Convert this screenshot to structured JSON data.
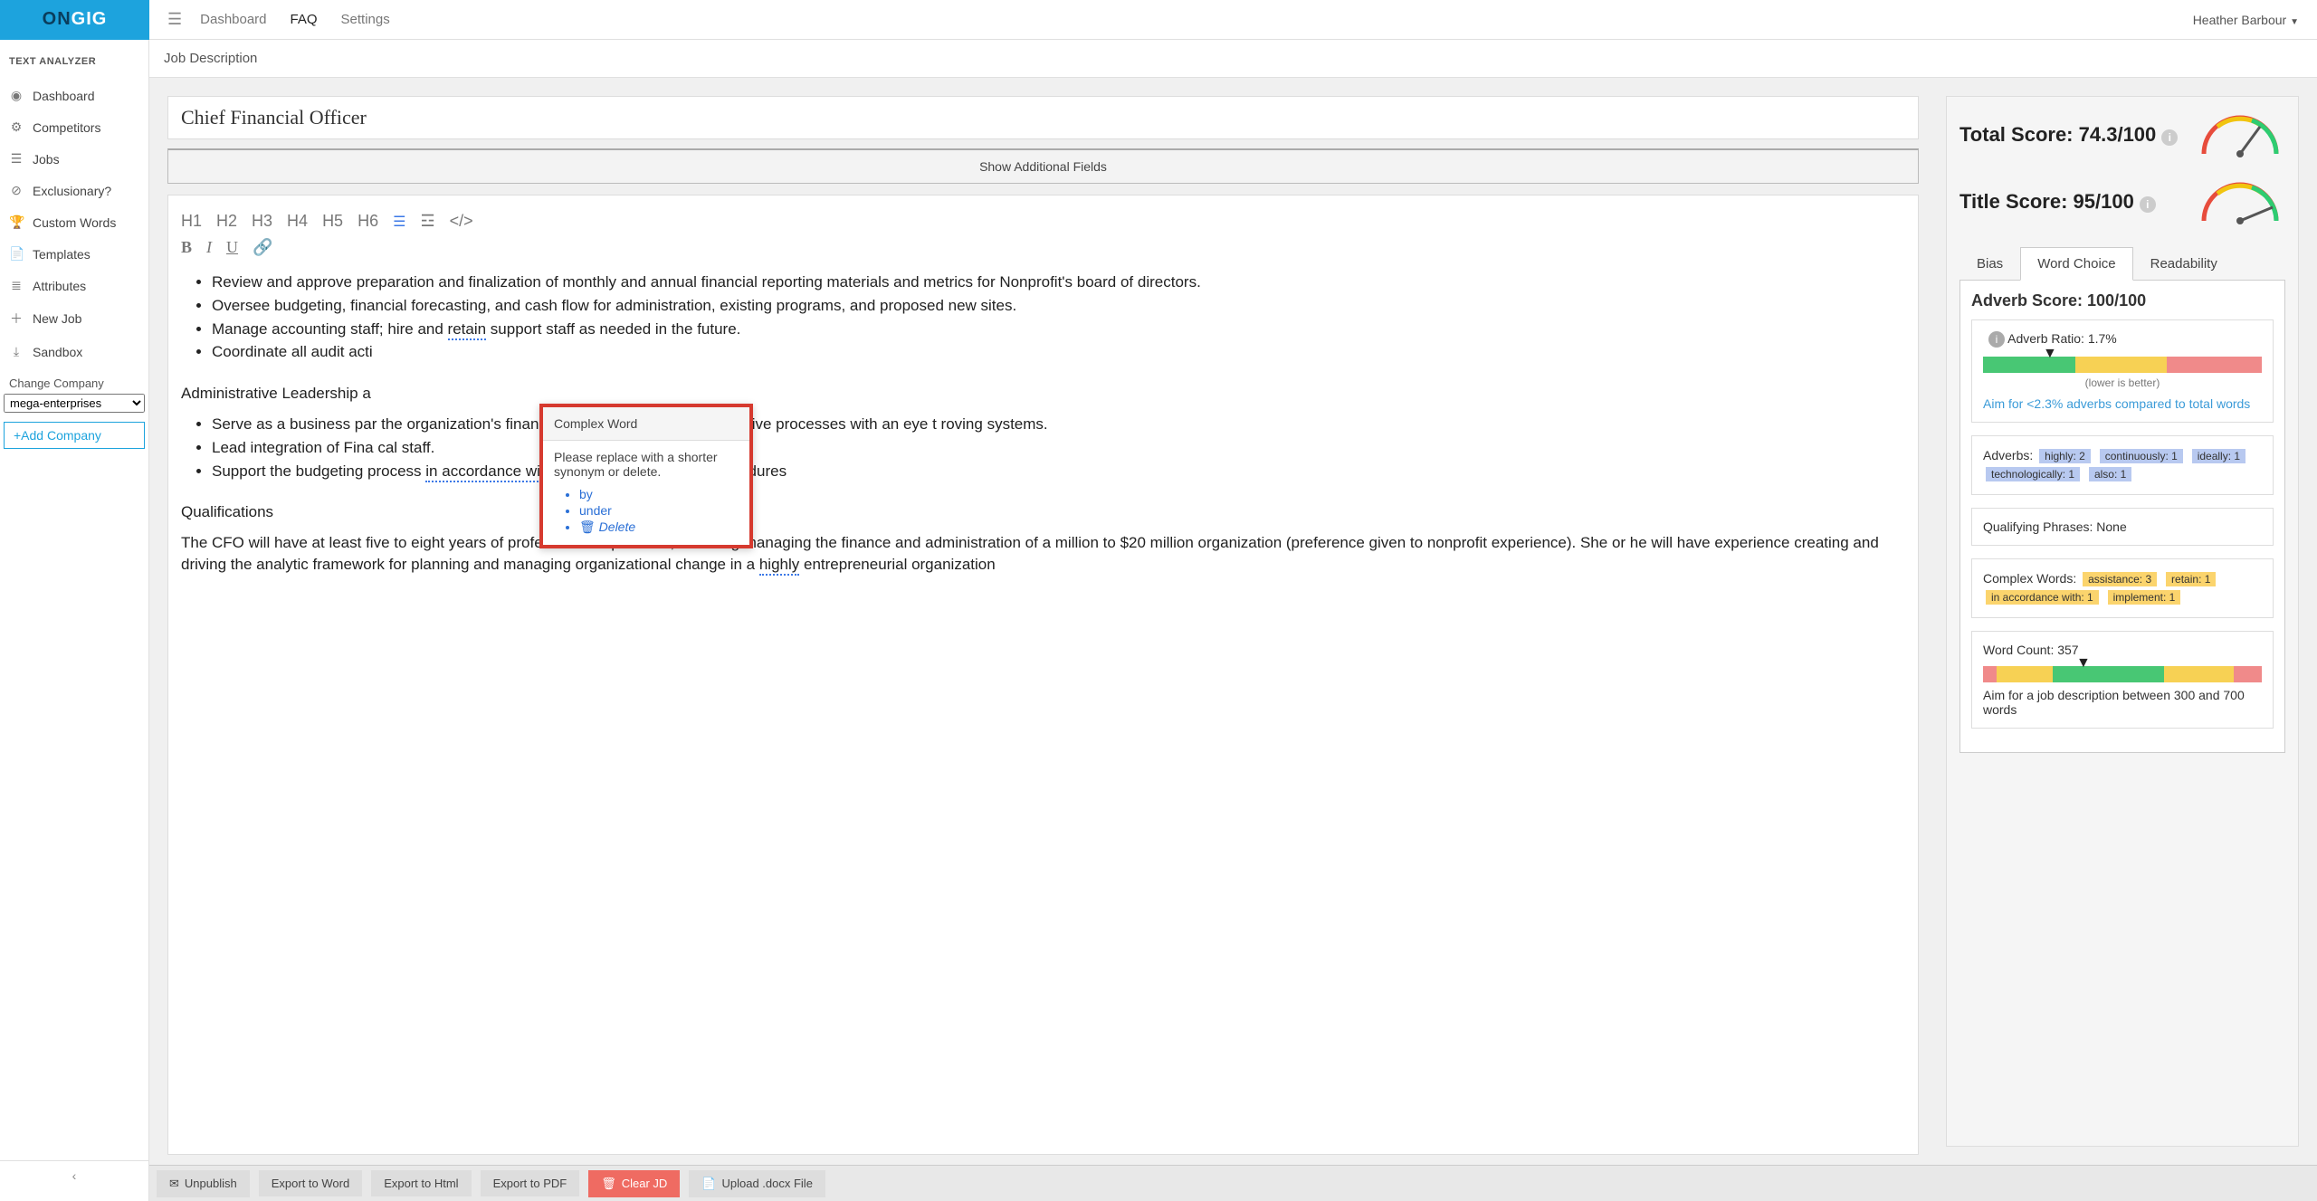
{
  "brand": {
    "part1": "ON",
    "part2": "GIG"
  },
  "topnav": {
    "dashboard": "Dashboard",
    "faq": "FAQ",
    "settings": "Settings"
  },
  "user": {
    "name": "Heather Barbour"
  },
  "sidebar": {
    "title": "TEXT ANALYZER",
    "items": [
      {
        "label": "Dashboard",
        "icon": "◉"
      },
      {
        "label": "Competitors",
        "icon": "⚙"
      },
      {
        "label": "Jobs",
        "icon": "☰"
      },
      {
        "label": "Exclusionary?",
        "icon": "⊘"
      },
      {
        "label": "Custom Words",
        "icon": "🏆"
      },
      {
        "label": "Templates",
        "icon": "📄"
      },
      {
        "label": "Attributes",
        "icon": "≣"
      },
      {
        "label": "New Job",
        "icon": "＋"
      },
      {
        "label": "Sandbox",
        "icon": "⤓"
      }
    ],
    "change_company": "Change Company",
    "company_value": "mega-enterprises",
    "add_company": "+Add Company"
  },
  "breadcrumb": "Job Description",
  "editor": {
    "title": "Chief Financial Officer",
    "show_fields": "Show Additional Fields",
    "headings": [
      "H1",
      "H2",
      "H3",
      "H4",
      "H5",
      "H6"
    ],
    "bullets": {
      "section1": [
        "Review and approve preparation and finalization of monthly and annual financial reporting materials and metrics for Nonprofit's board of directors.",
        "Oversee budgeting, financial forecasting, and cash flow for administration, existing programs, and proposed new sites.",
        "Manage accounting staff; hire and retain support staff as needed in the future.",
        "Coordinate all audit acti"
      ],
      "section2_title": "Administrative Leadership a",
      "section2": [
        "Serve as a business par                                                           the organization's financial, budgeting, and administrative processes with an eye t                                                          roving systems.",
        "Lead integration of Fina                                                                               cal staff.",
        "Support the budgeting process in accordance with company policies and procedures"
      ],
      "qual_title": "Qualifications",
      "qual_body": "The CFO will have at least five to eight years of professional experience, including managing the finance and administration of a million to $20 million organization (preference given to nonprofit experience). She or he will have experience creating and driving the analytic framework for planning and managing organizational change in a highly entrepreneurial organization"
    }
  },
  "popup": {
    "title": "Complex Word",
    "message": "Please replace with a shorter synonym or delete.",
    "options": [
      "by",
      "under"
    ],
    "delete": "Delete"
  },
  "scores": {
    "total_label": "Total Score:",
    "total_value": "74.3/100",
    "title_label": "Title Score:",
    "title_value": "95/100",
    "tabs": {
      "bias": "Bias",
      "word": "Word Choice",
      "read": "Readability"
    },
    "adverb_title": "Adverb Score: 100/100",
    "adverb_ratio": "Adverb Ratio: 1.7%",
    "bar_caption": "(lower is better)",
    "adverb_aim": "Aim for <2.3% adverbs compared to total words",
    "adverbs_label": "Adverbs:",
    "adverbs": [
      "highly: 2",
      "continuously: 1",
      "ideally: 1",
      "technologically: 1",
      "also: 1"
    ],
    "qualifying": "Qualifying Phrases: None",
    "complex_label": "Complex Words:",
    "complex": [
      "assistance: 3",
      "retain: 1",
      "in accordance with: 1",
      "implement: 1"
    ],
    "wordcount": "Word Count: 357",
    "wordcount_aim": "Aim for a job description between 300 and 700 words"
  },
  "bottombar": {
    "unpublish": "Unpublish",
    "word": "Export to Word",
    "html": "Export to Html",
    "pdf": "Export to PDF",
    "clear": "Clear JD",
    "upload": "Upload .docx File"
  },
  "chart_data": [
    {
      "type": "gauge",
      "name": "total-score",
      "value": 74.3,
      "min": 0,
      "max": 100,
      "zones": [
        {
          "color": "#e74c3c",
          "to": 40
        },
        {
          "color": "#f1c40f",
          "to": 70
        },
        {
          "color": "#2ecc71",
          "to": 100
        }
      ]
    },
    {
      "type": "gauge",
      "name": "title-score",
      "value": 95,
      "min": 0,
      "max": 100,
      "zones": [
        {
          "color": "#e74c3c",
          "to": 40
        },
        {
          "color": "#f1c40f",
          "to": 70
        },
        {
          "color": "#2ecc71",
          "to": 100
        }
      ]
    },
    {
      "type": "bar",
      "name": "adverb-ratio-bar",
      "value": 1.7,
      "pointer_pct": 24,
      "segments": [
        {
          "color": "#48c774",
          "pct": 33
        },
        {
          "color": "#f7d154",
          "pct": 33
        },
        {
          "color": "#f08a8a",
          "pct": 34
        }
      ],
      "caption": "(lower is better)"
    },
    {
      "type": "bar",
      "name": "word-count-bar",
      "value": 357,
      "pointer_pct": 36,
      "segments": [
        {
          "color": "#f08a8a",
          "pct": 5
        },
        {
          "color": "#f7d154",
          "pct": 20
        },
        {
          "color": "#48c774",
          "pct": 40
        },
        {
          "color": "#f7d154",
          "pct": 25
        },
        {
          "color": "#f08a8a",
          "pct": 10
        }
      ]
    }
  ]
}
